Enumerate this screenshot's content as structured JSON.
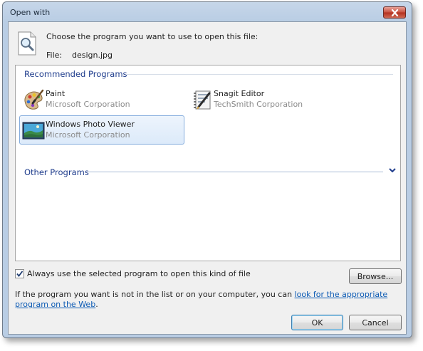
{
  "window": {
    "title": "Open with"
  },
  "header": {
    "prompt": "Choose the program you want to use to open this file:",
    "file_label": "File:",
    "file_name": "design.jpg"
  },
  "recommended": {
    "label": "Recommended Programs",
    "programs": [
      {
        "name": "Paint",
        "publisher": "Microsoft Corporation",
        "icon": "paint-icon",
        "selected": false
      },
      {
        "name": "Snagit Editor",
        "publisher": "TechSmith Corporation",
        "icon": "snagit-icon",
        "selected": false
      },
      {
        "name": "Windows Photo Viewer",
        "publisher": "Microsoft Corporation",
        "icon": "photo-viewer-icon",
        "selected": true
      }
    ]
  },
  "other": {
    "label": "Other Programs",
    "expanded": false
  },
  "always_use": {
    "label": "Always use the selected program to open this kind of file",
    "checked": true
  },
  "browse_label": "Browse...",
  "info": {
    "text": "If the program you want is not in the list or on your computer, you can ",
    "link": "look for the appropriate program on the Web",
    "end": "."
  },
  "buttons": {
    "ok": "OK",
    "cancel": "Cancel"
  },
  "colors": {
    "title_bar": "#b9cde4",
    "close_button": "#c7503f",
    "link": "#0b5ab4",
    "group_header": "#1e3c8c",
    "selection": "#dceafa"
  }
}
